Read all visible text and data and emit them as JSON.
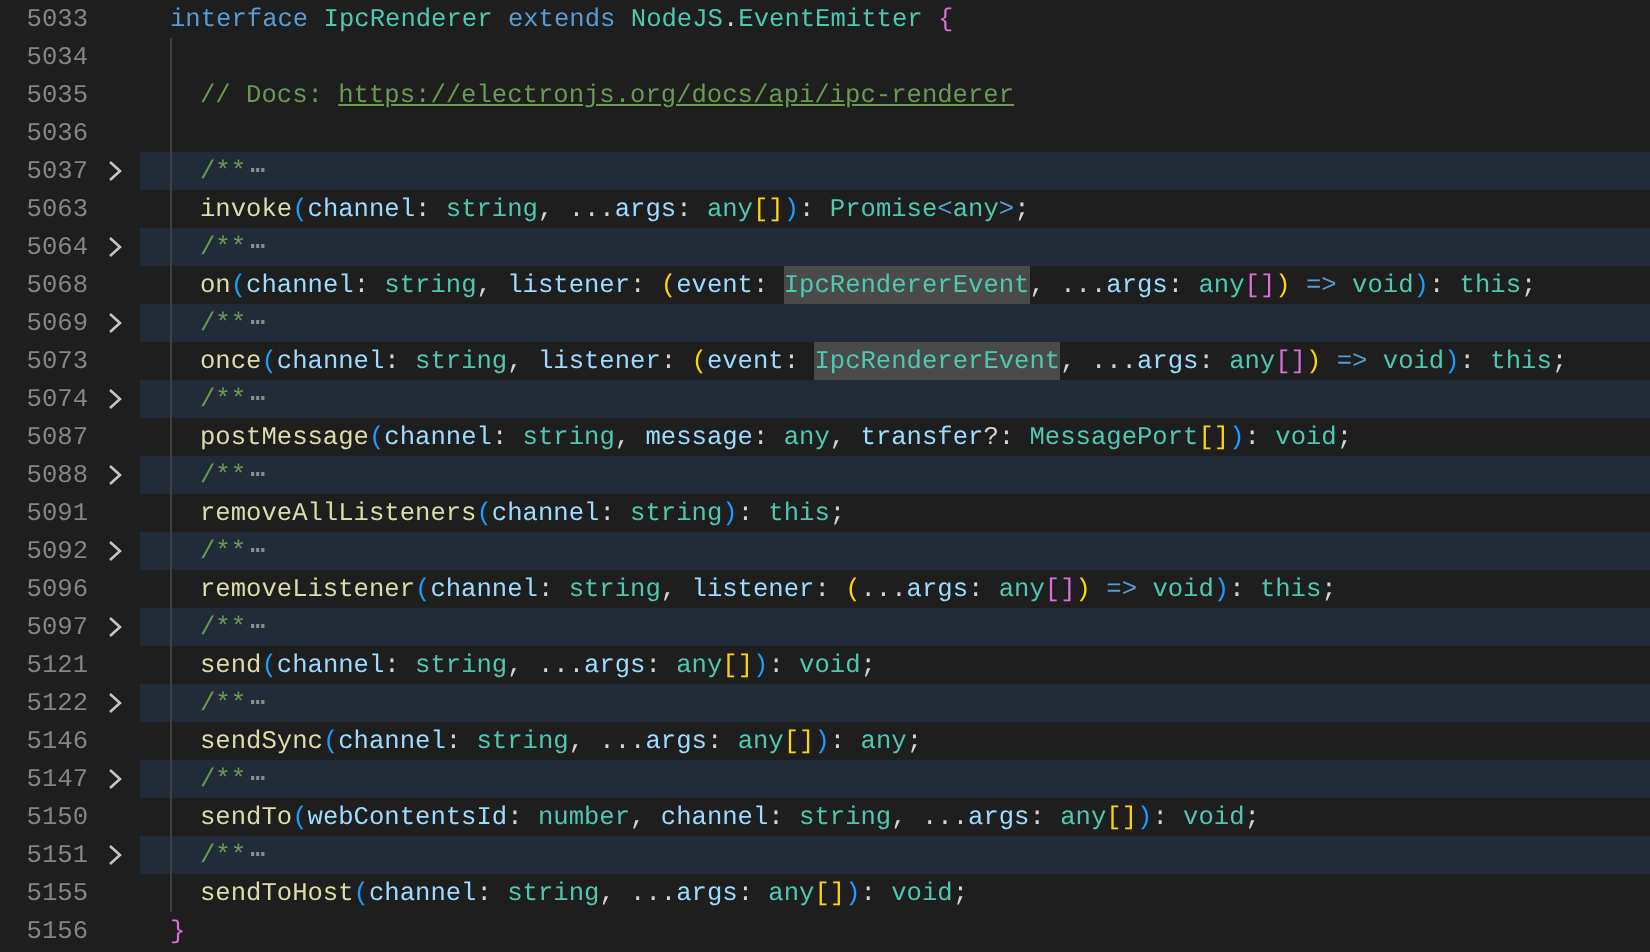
{
  "editor": {
    "lines": [
      {
        "number": "5033",
        "folded": false,
        "indented": false,
        "tokens": [
          {
            "kind": "keyword",
            "text": "interface "
          },
          {
            "kind": "type",
            "text": "IpcRenderer "
          },
          {
            "kind": "keyword",
            "text": "extends "
          },
          {
            "kind": "type",
            "text": "NodeJS"
          },
          {
            "kind": "punct",
            "text": "."
          },
          {
            "kind": "type",
            "text": "EventEmitter "
          },
          {
            "kind": "bracket",
            "text": "{",
            "color": "#da70d6"
          }
        ]
      },
      {
        "number": "5034",
        "folded": false,
        "indented": true
      },
      {
        "number": "5035",
        "folded": false,
        "indented": true,
        "tokens": [
          {
            "kind": "comment",
            "text": "// Docs: "
          },
          {
            "kind": "link",
            "text": "https://electronjs.org/docs/api/ipc-renderer"
          }
        ]
      },
      {
        "number": "5036",
        "folded": false,
        "indented": true
      },
      {
        "number": "5037",
        "folded": true,
        "indented": true,
        "tokens": [
          {
            "kind": "comment",
            "text": "/**"
          },
          {
            "kind": "fold",
            "text": "⋯"
          }
        ]
      },
      {
        "number": "5063",
        "folded": false,
        "indented": true,
        "tokens": [
          {
            "kind": "fn",
            "text": "invoke"
          },
          {
            "kind": "bracket",
            "text": "(",
            "color": "#179fff"
          },
          {
            "kind": "param",
            "text": "channel"
          },
          {
            "kind": "punct",
            "text": ": "
          },
          {
            "kind": "type",
            "text": "string"
          },
          {
            "kind": "punct",
            "text": ", ..."
          },
          {
            "kind": "param",
            "text": "args"
          },
          {
            "kind": "punct",
            "text": ": "
          },
          {
            "kind": "type",
            "text": "any"
          },
          {
            "kind": "bracket",
            "text": "[]",
            "color": "#ffd700"
          },
          {
            "kind": "bracket",
            "text": ")",
            "color": "#179fff"
          },
          {
            "kind": "punct",
            "text": ": "
          },
          {
            "kind": "type",
            "text": "Promise"
          },
          {
            "kind": "keyword",
            "text": "<"
          },
          {
            "kind": "type",
            "text": "any"
          },
          {
            "kind": "keyword",
            "text": ">"
          },
          {
            "kind": "punct",
            "text": ";"
          }
        ]
      },
      {
        "number": "5064",
        "folded": true,
        "indented": true,
        "tokens": [
          {
            "kind": "comment",
            "text": "/**"
          },
          {
            "kind": "fold",
            "text": "⋯"
          }
        ]
      },
      {
        "number": "5068",
        "folded": false,
        "indented": true,
        "tokens": [
          {
            "kind": "fn",
            "text": "on"
          },
          {
            "kind": "bracket",
            "text": "(",
            "color": "#179fff"
          },
          {
            "kind": "param",
            "text": "channel"
          },
          {
            "kind": "punct",
            "text": ": "
          },
          {
            "kind": "type",
            "text": "string"
          },
          {
            "kind": "punct",
            "text": ", "
          },
          {
            "kind": "param",
            "text": "listener"
          },
          {
            "kind": "punct",
            "text": ": "
          },
          {
            "kind": "bracket",
            "text": "(",
            "color": "#ffd700"
          },
          {
            "kind": "param",
            "text": "event"
          },
          {
            "kind": "punct",
            "text": ": "
          },
          {
            "kind": "type",
            "text": "IpcRendererEvent",
            "highlighted": true
          },
          {
            "kind": "punct",
            "text": ", ..."
          },
          {
            "kind": "param",
            "text": "args"
          },
          {
            "kind": "punct",
            "text": ": "
          },
          {
            "kind": "type",
            "text": "any"
          },
          {
            "kind": "bracket",
            "text": "[]",
            "color": "#da70d6"
          },
          {
            "kind": "bracket",
            "text": ")",
            "color": "#ffd700"
          },
          {
            "kind": "keyword",
            "text": " => "
          },
          {
            "kind": "type",
            "text": "void"
          },
          {
            "kind": "bracket",
            "text": ")",
            "color": "#179fff"
          },
          {
            "kind": "punct",
            "text": ": "
          },
          {
            "kind": "type",
            "text": "this"
          },
          {
            "kind": "punct",
            "text": ";"
          }
        ]
      },
      {
        "number": "5069",
        "folded": true,
        "indented": true,
        "tokens": [
          {
            "kind": "comment",
            "text": "/**"
          },
          {
            "kind": "fold",
            "text": "⋯"
          }
        ]
      },
      {
        "number": "5073",
        "folded": false,
        "indented": true,
        "tokens": [
          {
            "kind": "fn",
            "text": "once"
          },
          {
            "kind": "bracket",
            "text": "(",
            "color": "#179fff"
          },
          {
            "kind": "param",
            "text": "channel"
          },
          {
            "kind": "punct",
            "text": ": "
          },
          {
            "kind": "type",
            "text": "string"
          },
          {
            "kind": "punct",
            "text": ", "
          },
          {
            "kind": "param",
            "text": "listener"
          },
          {
            "kind": "punct",
            "text": ": "
          },
          {
            "kind": "bracket",
            "text": "(",
            "color": "#ffd700"
          },
          {
            "kind": "param",
            "text": "event"
          },
          {
            "kind": "punct",
            "text": ": "
          },
          {
            "kind": "type",
            "text": "IpcRendererEvent",
            "highlighted": true
          },
          {
            "kind": "punct",
            "text": ", ..."
          },
          {
            "kind": "param",
            "text": "args"
          },
          {
            "kind": "punct",
            "text": ": "
          },
          {
            "kind": "type",
            "text": "any"
          },
          {
            "kind": "bracket",
            "text": "[]",
            "color": "#da70d6"
          },
          {
            "kind": "bracket",
            "text": ")",
            "color": "#ffd700"
          },
          {
            "kind": "keyword",
            "text": " => "
          },
          {
            "kind": "type",
            "text": "void"
          },
          {
            "kind": "bracket",
            "text": ")",
            "color": "#179fff"
          },
          {
            "kind": "punct",
            "text": ": "
          },
          {
            "kind": "type",
            "text": "this"
          },
          {
            "kind": "punct",
            "text": ";"
          }
        ]
      },
      {
        "number": "5074",
        "folded": true,
        "indented": true,
        "tokens": [
          {
            "kind": "comment",
            "text": "/**"
          },
          {
            "kind": "fold",
            "text": "⋯"
          }
        ]
      },
      {
        "number": "5087",
        "folded": false,
        "indented": true,
        "tokens": [
          {
            "kind": "fn",
            "text": "postMessage"
          },
          {
            "kind": "bracket",
            "text": "(",
            "color": "#179fff"
          },
          {
            "kind": "param",
            "text": "channel"
          },
          {
            "kind": "punct",
            "text": ": "
          },
          {
            "kind": "type",
            "text": "string"
          },
          {
            "kind": "punct",
            "text": ", "
          },
          {
            "kind": "param",
            "text": "message"
          },
          {
            "kind": "punct",
            "text": ": "
          },
          {
            "kind": "type",
            "text": "any"
          },
          {
            "kind": "punct",
            "text": ", "
          },
          {
            "kind": "param",
            "text": "transfer"
          },
          {
            "kind": "punct",
            "text": "?: "
          },
          {
            "kind": "type",
            "text": "MessagePort"
          },
          {
            "kind": "bracket",
            "text": "[]",
            "color": "#ffd700"
          },
          {
            "kind": "bracket",
            "text": ")",
            "color": "#179fff"
          },
          {
            "kind": "punct",
            "text": ": "
          },
          {
            "kind": "type",
            "text": "void"
          },
          {
            "kind": "punct",
            "text": ";"
          }
        ]
      },
      {
        "number": "5088",
        "folded": true,
        "indented": true,
        "tokens": [
          {
            "kind": "comment",
            "text": "/**"
          },
          {
            "kind": "fold",
            "text": "⋯"
          }
        ]
      },
      {
        "number": "5091",
        "folded": false,
        "indented": true,
        "tokens": [
          {
            "kind": "fn",
            "text": "removeAllListeners"
          },
          {
            "kind": "bracket",
            "text": "(",
            "color": "#179fff"
          },
          {
            "kind": "param",
            "text": "channel"
          },
          {
            "kind": "punct",
            "text": ": "
          },
          {
            "kind": "type",
            "text": "string"
          },
          {
            "kind": "bracket",
            "text": ")",
            "color": "#179fff"
          },
          {
            "kind": "punct",
            "text": ": "
          },
          {
            "kind": "type",
            "text": "this"
          },
          {
            "kind": "punct",
            "text": ";"
          }
        ]
      },
      {
        "number": "5092",
        "folded": true,
        "indented": true,
        "tokens": [
          {
            "kind": "comment",
            "text": "/**"
          },
          {
            "kind": "fold",
            "text": "⋯"
          }
        ]
      },
      {
        "number": "5096",
        "folded": false,
        "indented": true,
        "tokens": [
          {
            "kind": "fn",
            "text": "removeListener"
          },
          {
            "kind": "bracket",
            "text": "(",
            "color": "#179fff"
          },
          {
            "kind": "param",
            "text": "channel"
          },
          {
            "kind": "punct",
            "text": ": "
          },
          {
            "kind": "type",
            "text": "string"
          },
          {
            "kind": "punct",
            "text": ", "
          },
          {
            "kind": "param",
            "text": "listener"
          },
          {
            "kind": "punct",
            "text": ": "
          },
          {
            "kind": "bracket",
            "text": "(",
            "color": "#ffd700"
          },
          {
            "kind": "punct",
            "text": "..."
          },
          {
            "kind": "param",
            "text": "args"
          },
          {
            "kind": "punct",
            "text": ": "
          },
          {
            "kind": "type",
            "text": "any"
          },
          {
            "kind": "bracket",
            "text": "[]",
            "color": "#da70d6"
          },
          {
            "kind": "bracket",
            "text": ")",
            "color": "#ffd700"
          },
          {
            "kind": "keyword",
            "text": " => "
          },
          {
            "kind": "type",
            "text": "void"
          },
          {
            "kind": "bracket",
            "text": ")",
            "color": "#179fff"
          },
          {
            "kind": "punct",
            "text": ": "
          },
          {
            "kind": "type",
            "text": "this"
          },
          {
            "kind": "punct",
            "text": ";"
          }
        ]
      },
      {
        "number": "5097",
        "folded": true,
        "indented": true,
        "tokens": [
          {
            "kind": "comment",
            "text": "/**"
          },
          {
            "kind": "fold",
            "text": "⋯"
          }
        ]
      },
      {
        "number": "5121",
        "folded": false,
        "indented": true,
        "tokens": [
          {
            "kind": "fn",
            "text": "send"
          },
          {
            "kind": "bracket",
            "text": "(",
            "color": "#179fff"
          },
          {
            "kind": "param",
            "text": "channel"
          },
          {
            "kind": "punct",
            "text": ": "
          },
          {
            "kind": "type",
            "text": "string"
          },
          {
            "kind": "punct",
            "text": ", ..."
          },
          {
            "kind": "param",
            "text": "args"
          },
          {
            "kind": "punct",
            "text": ": "
          },
          {
            "kind": "type",
            "text": "any"
          },
          {
            "kind": "bracket",
            "text": "[]",
            "color": "#ffd700"
          },
          {
            "kind": "bracket",
            "text": ")",
            "color": "#179fff"
          },
          {
            "kind": "punct",
            "text": ": "
          },
          {
            "kind": "type",
            "text": "void"
          },
          {
            "kind": "punct",
            "text": ";"
          }
        ]
      },
      {
        "number": "5122",
        "folded": true,
        "indented": true,
        "tokens": [
          {
            "kind": "comment",
            "text": "/**"
          },
          {
            "kind": "fold",
            "text": "⋯"
          }
        ]
      },
      {
        "number": "5146",
        "folded": false,
        "indented": true,
        "tokens": [
          {
            "kind": "fn",
            "text": "sendSync"
          },
          {
            "kind": "bracket",
            "text": "(",
            "color": "#179fff"
          },
          {
            "kind": "param",
            "text": "channel"
          },
          {
            "kind": "punct",
            "text": ": "
          },
          {
            "kind": "type",
            "text": "string"
          },
          {
            "kind": "punct",
            "text": ", ..."
          },
          {
            "kind": "param",
            "text": "args"
          },
          {
            "kind": "punct",
            "text": ": "
          },
          {
            "kind": "type",
            "text": "any"
          },
          {
            "kind": "bracket",
            "text": "[]",
            "color": "#ffd700"
          },
          {
            "kind": "bracket",
            "text": ")",
            "color": "#179fff"
          },
          {
            "kind": "punct",
            "text": ": "
          },
          {
            "kind": "type",
            "text": "any"
          },
          {
            "kind": "punct",
            "text": ";"
          }
        ]
      },
      {
        "number": "5147",
        "folded": true,
        "indented": true,
        "tokens": [
          {
            "kind": "comment",
            "text": "/**"
          },
          {
            "kind": "fold",
            "text": "⋯"
          }
        ]
      },
      {
        "number": "5150",
        "folded": false,
        "indented": true,
        "tokens": [
          {
            "kind": "fn",
            "text": "sendTo"
          },
          {
            "kind": "bracket",
            "text": "(",
            "color": "#179fff"
          },
          {
            "kind": "param",
            "text": "webContentsId"
          },
          {
            "kind": "punct",
            "text": ": "
          },
          {
            "kind": "type",
            "text": "number"
          },
          {
            "kind": "punct",
            "text": ", "
          },
          {
            "kind": "param",
            "text": "channel"
          },
          {
            "kind": "punct",
            "text": ": "
          },
          {
            "kind": "type",
            "text": "string"
          },
          {
            "kind": "punct",
            "text": ", ..."
          },
          {
            "kind": "param",
            "text": "args"
          },
          {
            "kind": "punct",
            "text": ": "
          },
          {
            "kind": "type",
            "text": "any"
          },
          {
            "kind": "bracket",
            "text": "[]",
            "color": "#ffd700"
          },
          {
            "kind": "bracket",
            "text": ")",
            "color": "#179fff"
          },
          {
            "kind": "punct",
            "text": ": "
          },
          {
            "kind": "type",
            "text": "void"
          },
          {
            "kind": "punct",
            "text": ";"
          }
        ]
      },
      {
        "number": "5151",
        "folded": true,
        "indented": true,
        "tokens": [
          {
            "kind": "comment",
            "text": "/**"
          },
          {
            "kind": "fold",
            "text": "⋯"
          }
        ]
      },
      {
        "number": "5155",
        "folded": false,
        "indented": true,
        "tokens": [
          {
            "kind": "fn",
            "text": "sendToHost"
          },
          {
            "kind": "bracket",
            "text": "(",
            "color": "#179fff"
          },
          {
            "kind": "param",
            "text": "channel"
          },
          {
            "kind": "punct",
            "text": ": "
          },
          {
            "kind": "type",
            "text": "string"
          },
          {
            "kind": "punct",
            "text": ", ..."
          },
          {
            "kind": "param",
            "text": "args"
          },
          {
            "kind": "punct",
            "text": ": "
          },
          {
            "kind": "type",
            "text": "any"
          },
          {
            "kind": "bracket",
            "text": "[]",
            "color": "#ffd700"
          },
          {
            "kind": "bracket",
            "text": ")",
            "color": "#179fff"
          },
          {
            "kind": "punct",
            "text": ": "
          },
          {
            "kind": "type",
            "text": "void"
          },
          {
            "kind": "punct",
            "text": ";"
          }
        ]
      },
      {
        "number": "5156",
        "folded": false,
        "indented": false,
        "tokens": [
          {
            "kind": "bracket",
            "text": "}",
            "color": "#da70d6"
          }
        ]
      }
    ]
  }
}
